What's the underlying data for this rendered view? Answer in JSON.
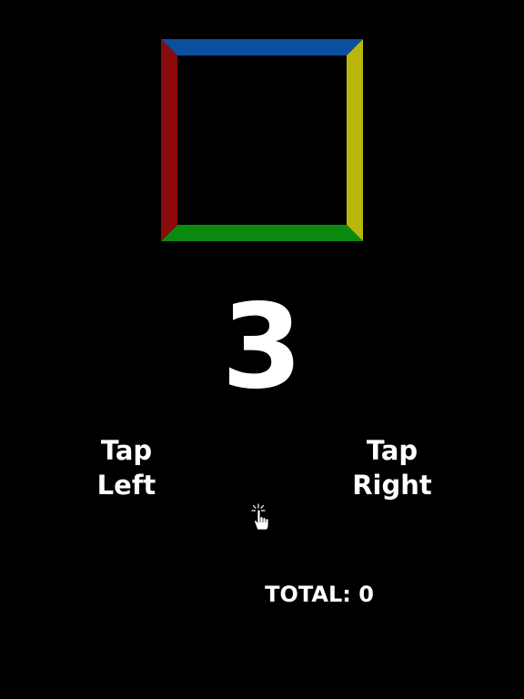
{
  "game": {
    "countdown": "3",
    "tap_left": {
      "line1": "Tap",
      "line2": "Left"
    },
    "tap_right": {
      "line1": "Tap",
      "line2": "Right"
    },
    "total_label": "TOTAL: 0"
  },
  "frame_colors": {
    "top": "#0b4f9e",
    "right": "#b9b80a",
    "bottom": "#0b8a12",
    "left": "#8a0c0c"
  },
  "icons": {
    "hint": "tap-hand-icon"
  }
}
